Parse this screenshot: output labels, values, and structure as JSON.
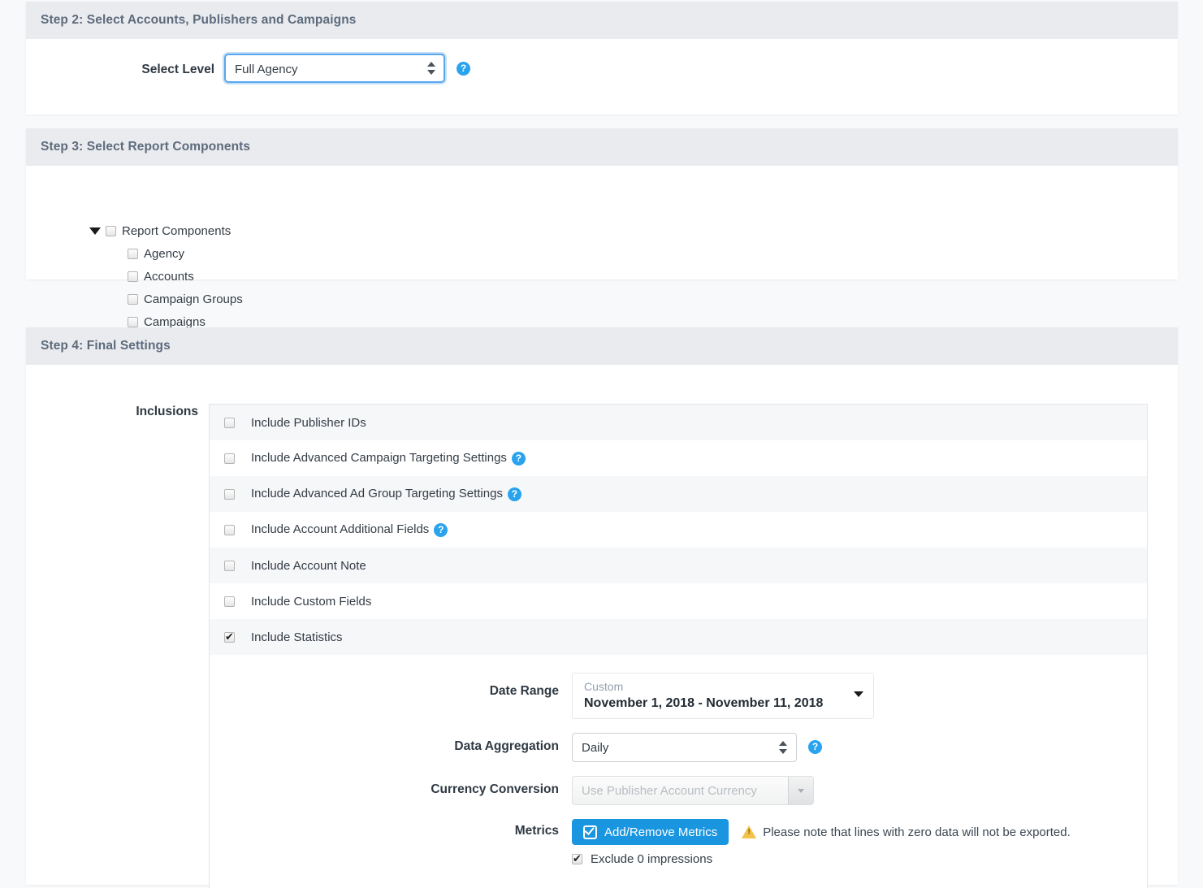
{
  "step2": {
    "header": "Step 2: Select Accounts, Publishers and Campaigns",
    "select_level_label": "Select Level",
    "select_level_value": "Full Agency",
    "select_level_options": [
      "Full Agency"
    ],
    "help_icon": "help-icon",
    "help_glyph": "?"
  },
  "step3": {
    "header": "Step 3: Select Report Components",
    "tree": {
      "root_label": "Report Components",
      "root_checked": false,
      "expanded": true,
      "caret_icon": "caret-down-icon",
      "children": [
        {
          "label": "Agency",
          "checked": false
        },
        {
          "label": "Accounts",
          "checked": false
        },
        {
          "label": "Campaign Groups",
          "checked": false
        },
        {
          "label": "Campaigns",
          "checked": false
        }
      ]
    }
  },
  "step4": {
    "header": "Step 4: Final Settings",
    "inclusions_label": "Inclusions",
    "inclusions": [
      {
        "label": "Include Publisher IDs",
        "checked": false,
        "help": false
      },
      {
        "label": "Include Advanced Campaign Targeting Settings",
        "checked": false,
        "help": true
      },
      {
        "label": "Include Advanced Ad Group Targeting Settings",
        "checked": false,
        "help": true
      },
      {
        "label": "Include Account Additional Fields",
        "checked": false,
        "help": true
      },
      {
        "label": "Include Account Note",
        "checked": false,
        "help": false
      },
      {
        "label": "Include Custom Fields",
        "checked": false,
        "help": false
      },
      {
        "label": "Include Statistics",
        "checked": true,
        "help": false
      }
    ],
    "date_range": {
      "label": "Date Range",
      "preset": "Custom",
      "value": "November 1, 2018 - November 11, 2018",
      "caret_icon": "caret-down-icon"
    },
    "data_aggregation": {
      "label": "Data Aggregation",
      "value": "Daily",
      "options": [
        "Daily"
      ],
      "help": true
    },
    "currency_conversion": {
      "label": "Currency Conversion",
      "value": "Use Publisher Account Currency",
      "options": [
        "Use Publisher Account Currency"
      ],
      "disabled": true
    },
    "metrics": {
      "label": "Metrics",
      "button_label": "Add/Remove Metrics",
      "button_icon": "check-square-icon",
      "note": "Please note that lines with zero data will not be exported.",
      "note_icon": "warning-triangle-icon",
      "exclude_label": "Exclude 0 impressions",
      "exclude_checked": true
    }
  },
  "colors": {
    "accent_blue": "#1a96e0",
    "help_blue": "#29a3ee",
    "panel_header_bg": "#e9ebef",
    "page_bg": "#f8f9fa",
    "warning_yellow": "#f3c24a"
  }
}
